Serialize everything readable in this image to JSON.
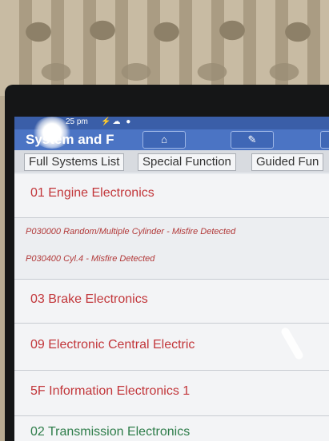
{
  "statusbar": {
    "time": "25 pm",
    "icons": "⚡☁ ●"
  },
  "titlebar": {
    "title": "System and F",
    "home_icon": "home-icon",
    "report_icon": "edit-icon"
  },
  "tabs": [
    {
      "label": "Full Systems List"
    },
    {
      "label": "Special Function"
    },
    {
      "label": "Guided Fun"
    }
  ],
  "systems": [
    {
      "label": "01 Engine Electronics"
    },
    {
      "label": "03 Brake Electronics"
    },
    {
      "label": "09 Electronic Central Electric"
    },
    {
      "label": "5F Information Electronics 1"
    },
    {
      "label": "02 Transmission Electronics"
    }
  ],
  "dtcs": [
    {
      "text": "P030000 Random/Multiple Cylinder - Misfire Detected"
    },
    {
      "text": "P030400 Cyl.4 - Misfire Detected"
    }
  ],
  "colors": {
    "header": "#4b74c4",
    "fault_text": "#c2363a",
    "ok_text": "#2e7d4a"
  }
}
